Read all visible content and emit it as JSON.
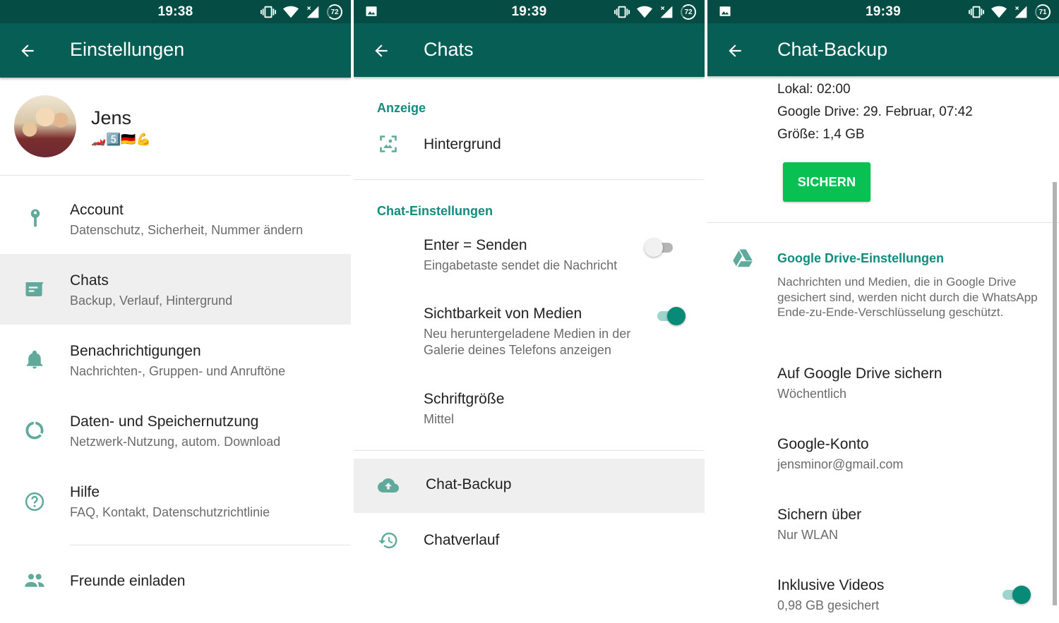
{
  "colors": {
    "status_bar": "#054d44",
    "app_bar": "#075e54",
    "accent": "#128c7e",
    "icon_tint": "#5faa9b",
    "toggle_on": "#078b77",
    "backup_button": "#09c152",
    "highlight_row": "#efefef"
  },
  "screens": [
    {
      "status": {
        "time": "19:38",
        "battery": "72",
        "icons": [
          "vibrate-icon",
          "wifi-icon",
          "signal-icon",
          "battery-saver-icon"
        ]
      },
      "title": "Einstellungen",
      "profile": {
        "name": "Jens",
        "status_emoji": "🏎️5️⃣🇩🇪💪"
      },
      "items": [
        {
          "icon": "key-icon",
          "title": "Account",
          "subtitle": "Datenschutz, Sicherheit, Nummer ändern"
        },
        {
          "icon": "chat-icon",
          "title": "Chats",
          "subtitle": "Backup, Verlauf, Hintergrund",
          "selected": true
        },
        {
          "icon": "bell-icon",
          "title": "Benachrichtigungen",
          "subtitle": "Nachrichten-, Gruppen- und Anruftöne"
        },
        {
          "icon": "data-usage-icon",
          "title": "Daten- und Speichernutzung",
          "subtitle": "Netzwerk-Nutzung, autom. Download"
        },
        {
          "icon": "help-icon",
          "title": "Hilfe",
          "subtitle": "FAQ, Kontakt, Datenschutzrichtlinie"
        },
        {
          "icon": "people-icon",
          "title": "Freunde einladen"
        }
      ]
    },
    {
      "status": {
        "time": "19:39",
        "battery": "72",
        "icons": [
          "gallery-icon",
          "vibrate-icon",
          "wifi-icon",
          "signal-icon",
          "battery-saver-icon"
        ]
      },
      "title": "Chats",
      "sections": {
        "display": "Anzeige",
        "chat_settings": "Chat-Einstellungen"
      },
      "wallpaper": {
        "icon": "wallpaper-icon",
        "title": "Hintergrund"
      },
      "enter_send": {
        "title": "Enter = Senden",
        "subtitle": "Eingabetaste sendet die Nachricht",
        "enabled": false
      },
      "media_visibility": {
        "title": "Sichtbarkeit von Medien",
        "subtitle_line1": "Neu heruntergeladene Medien in der",
        "subtitle_line2": "Galerie deines Telefons anzeigen",
        "enabled": true
      },
      "font_size": {
        "title": "Schriftgröße",
        "value": "Mittel"
      },
      "chat_backup": {
        "icon": "cloud-upload-icon",
        "title": "Chat-Backup",
        "selected": true
      },
      "chat_history": {
        "icon": "history-icon",
        "title": "Chatverlauf"
      }
    },
    {
      "status": {
        "time": "19:39",
        "battery": "71",
        "icons": [
          "gallery-icon",
          "vibrate-icon",
          "wifi-icon",
          "signal-icon",
          "battery-saver-icon"
        ]
      },
      "title": "Chat-Backup",
      "last_backup": {
        "local": "Lokal: 02:00",
        "google_drive": "Google Drive: 29. Februar, 07:42",
        "size": "Größe: 1,4 GB"
      },
      "backup_button": "SICHERN",
      "drive_section": {
        "title": "Google Drive-Einstellungen",
        "description": "Nachrichten und Medien, die in Google Drive gesichert sind, werden nicht durch die WhatsApp Ende-zu-Ende-Verschlüsselung geschützt."
      },
      "backup_frequency": {
        "title": "Auf Google Drive sichern",
        "value": "Wöchentlich"
      },
      "account": {
        "title": "Google-Konto",
        "value": "jensminor@gmail.com"
      },
      "backup_over": {
        "title": "Sichern über",
        "value": "Nur WLAN"
      },
      "include_videos": {
        "title": "Inklusive Videos",
        "value": "0,98 GB gesichert",
        "enabled": true
      }
    }
  ]
}
